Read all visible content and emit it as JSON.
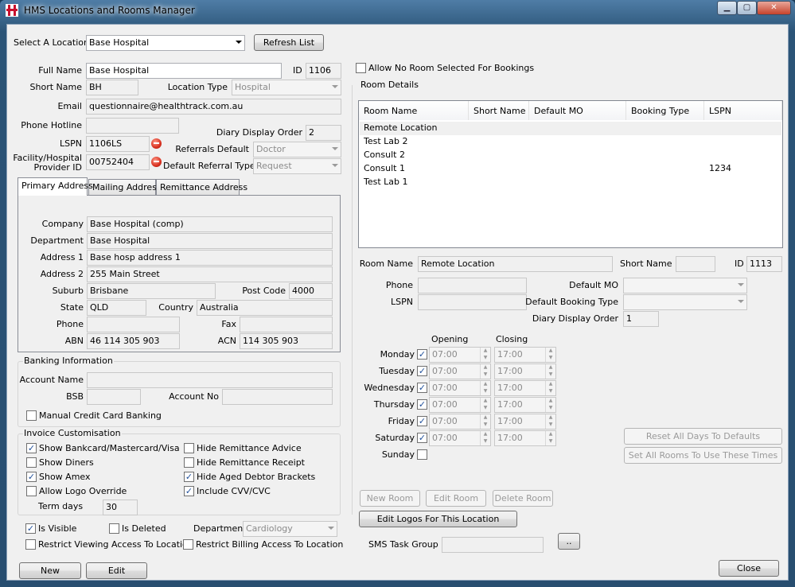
{
  "window": {
    "title": "HMS Locations and Rooms Manager",
    "min_glyph": "▁",
    "max_glyph": "▢",
    "close_glyph": "✕",
    "icon": "red-cross-icon",
    "accent": "#c8102e"
  },
  "location_select": {
    "label": "Select A Location",
    "value": "Base Hospital",
    "refresh_label": "Refresh List"
  },
  "location": {
    "full_name_label": "Full Name",
    "full_name": "Base Hospital",
    "id_label": "ID",
    "id": "1106",
    "short_name_label": "Short Name",
    "short_name": "BH",
    "location_type_label": "Location Type",
    "location_type": "Hospital",
    "email_label": "Email",
    "email": "questionnaire@healthtrack.com.au",
    "phone_hotline_label": "Phone Hotline",
    "phone_hotline": "",
    "diary_display_order_label": "Diary Display Order",
    "diary_display_order": "2",
    "lspn_label": "LSPN",
    "lspn": "1106LS",
    "referrals_default_label": "Referrals Default",
    "referrals_default": "Doctor",
    "provider_id_label_1": "Facility/Hospital",
    "provider_id_label_2": "Provider ID",
    "provider_id": "00752404",
    "default_referral_type_label": "Default Referral Type",
    "default_referral_type": "Request"
  },
  "tabs": [
    {
      "label": "Primary Address"
    },
    {
      "label": "Mailing Address"
    },
    {
      "label": "Remittance Address"
    }
  ],
  "address": {
    "company_label": "Company",
    "company": "Base Hospital (comp)",
    "department_label": "Department",
    "department": "Base Hospital",
    "address1_label": "Address 1",
    "address1": "Base hosp address 1",
    "address2_label": "Address 2",
    "address2": "255 Main Street",
    "suburb_label": "Suburb",
    "suburb": "Brisbane",
    "postcode_label": "Post Code",
    "postcode": "4000",
    "state_label": "State",
    "state": "QLD",
    "country_label": "Country",
    "country": "Australia",
    "phone_label": "Phone",
    "phone": "",
    "fax_label": "Fax",
    "fax": "",
    "abn_label": "ABN",
    "abn": "46 114 305 903",
    "acn_label": "ACN",
    "acn": "114 305 903"
  },
  "banking": {
    "title": "Banking Information",
    "account_name_label": "Account Name",
    "account_name": "",
    "bsb_label": "BSB",
    "bsb": "",
    "account_no_label": "Account No",
    "account_no": "",
    "manual_cc_label": "Manual Credit Card Banking"
  },
  "invoice": {
    "title": "Invoice Customisation",
    "show_bankcard": "Show Bankcard/Mastercard/Visa",
    "show_diners": "Show Diners",
    "show_amex": "Show Amex",
    "allow_logo": "Allow Logo Override",
    "hide_advice": "Hide Remittance Advice",
    "hide_receipt": "Hide Remittance Receipt",
    "hide_aged": "Hide Aged Debtor Brackets",
    "include_cvv": "Include CVV/CVC",
    "term_days_label": "Term days",
    "term_days": "30"
  },
  "visibility": {
    "is_visible": "Is Visible",
    "is_deleted": "Is Deleted",
    "department_label": "Department",
    "department": "Cardiology",
    "restrict_viewing": "Restrict Viewing Access To Location",
    "restrict_billing": "Restrict Billing Access To Location"
  },
  "bottom_buttons": {
    "new": "New",
    "edit": "Edit",
    "close": "Close"
  },
  "allow_no_room": "Allow No Room Selected For Bookings",
  "room_details": {
    "title": "Room Details",
    "columns": [
      "Room Name",
      "Short Name",
      "Default MO",
      "Booking Type",
      "LSPN"
    ],
    "rows": [
      [
        "Remote Location",
        "",
        "",
        "",
        ""
      ],
      [
        "Test Lab 2",
        "",
        "",
        "",
        ""
      ],
      [
        "Consult 2",
        "",
        "",
        "",
        ""
      ],
      [
        "Consult 1",
        "",
        "",
        "",
        "1234"
      ],
      [
        "Test Lab 1",
        "",
        "",
        "",
        ""
      ]
    ]
  },
  "room_form": {
    "room_name_label": "Room Name",
    "room_name": "Remote Location",
    "short_name_label": "Short Name",
    "short_name": "",
    "id_label": "ID",
    "id": "1113",
    "phone_label": "Phone",
    "phone": "",
    "default_mo_label": "Default MO",
    "default_mo": "",
    "lspn_label": "LSPN",
    "lspn": "",
    "default_booking_type_label": "Default Booking Type",
    "default_booking_type": "",
    "diary_order_label": "Diary Display Order",
    "diary_order": "1",
    "opening_label": "Opening",
    "closing_label": "Closing",
    "days": [
      {
        "name": "Monday",
        "open": "07:00",
        "close": "17:00",
        "checked": true
      },
      {
        "name": "Tuesday",
        "open": "07:00",
        "close": "17:00",
        "checked": true
      },
      {
        "name": "Wednesday",
        "open": "07:00",
        "close": "17:00",
        "checked": true
      },
      {
        "name": "Thursday",
        "open": "07:00",
        "close": "17:00",
        "checked": true
      },
      {
        "name": "Friday",
        "open": "07:00",
        "close": "17:00",
        "checked": true
      },
      {
        "name": "Saturday",
        "open": "07:00",
        "close": "17:00",
        "checked": true
      },
      {
        "name": "Sunday",
        "open": "",
        "close": "",
        "checked": false
      }
    ],
    "reset_days": "Reset All Days To Defaults",
    "set_all_rooms": "Set All Rooms To Use These Times",
    "new_room": "New Room",
    "edit_room": "Edit Room",
    "delete_room": "Delete Room",
    "edit_logos": "Edit Logos For This Location",
    "sms_task_group_label": "SMS Task Group",
    "sms_task_group": "",
    "sms_browse": ".."
  },
  "check": "✓"
}
